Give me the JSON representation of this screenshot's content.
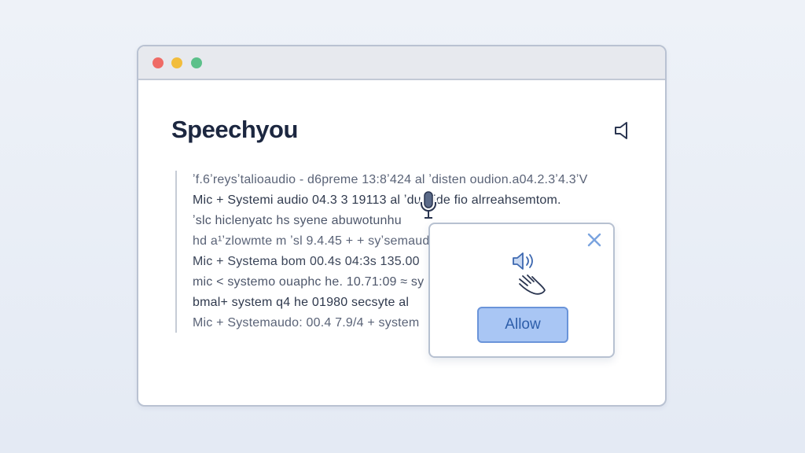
{
  "app": {
    "title": "Speechyou"
  },
  "transcript": {
    "lines": [
      "ʼf.6ʼreysʼtalioaudio - d6preme  13:8ʼ424  al  ʼdisten  oudion.a04.2.3ʼ4.3ʼV",
      "Mic + Systemi audio 04.3 3 19113  al  ʼdu  Vide fio alrreahsemtom.",
      "ʼslc hiclenyatc hs syene abuwotunhu",
      "hd a¹ʼzlowmte m ʼsl 9.4.45  + + syʼsemaud",
      "Mic + Systema bom  00.4s  04:3s  135.00",
      "mic < systemo ouaphc he. 10.71:09 ≈ sy",
      "bmal+ system q4 he  01980  secsyte  al",
      "Mic + Systemaudo:  00.4 7.9/4 + system"
    ]
  },
  "permission_popup": {
    "allow_label": "Allow"
  },
  "icons": {
    "speaker": "speaker-icon",
    "microphone": "microphone-icon",
    "close": "close-icon",
    "hand": "hand-icon"
  },
  "colors": {
    "accent": "#6a94d9",
    "allow_fill": "#a9c6f4",
    "title_text": "#1c2740",
    "close": "#7aa3df"
  }
}
